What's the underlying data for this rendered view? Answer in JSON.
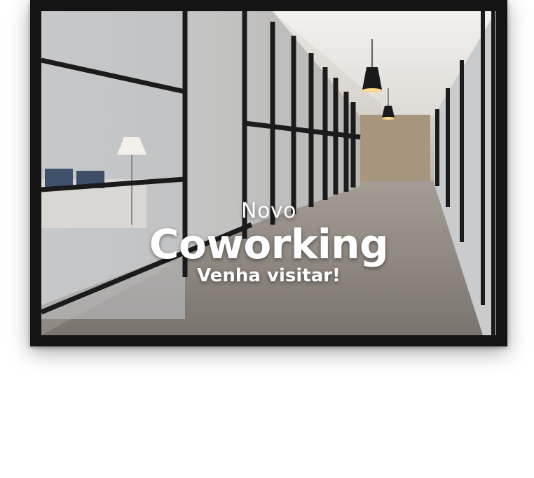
{
  "poster": {
    "line1": "Novo",
    "line2": "Coworking",
    "line3": "Venha visitar!"
  },
  "colors": {
    "frame": "#141414",
    "text": "#ffffff",
    "wall_back": "#a8957f",
    "glass_frame": "#1b1b1b"
  }
}
